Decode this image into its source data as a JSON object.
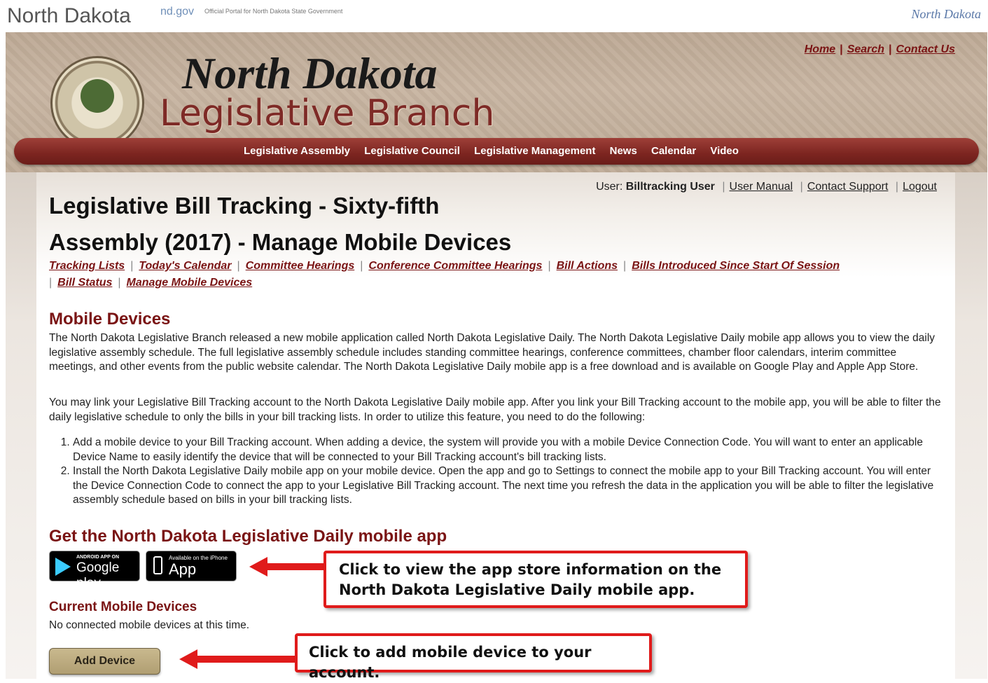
{
  "portal": {
    "name": "North Dakota",
    "ndgov": "nd.gov",
    "description": "Official Portal for North Dakota State Government",
    "logo_text": "North Dakota"
  },
  "header": {
    "title_line1": "North Dakota",
    "title_line2": "Legislative Branch",
    "top_links": [
      "Home",
      "Search",
      "Contact Us"
    ],
    "nav_items": [
      "Legislative Assembly",
      "Legislative Council",
      "Legislative Management",
      "News",
      "Calendar",
      "Video"
    ]
  },
  "user_bar": {
    "user_label": "User:",
    "user_name": "Billtracking User",
    "links": [
      "User Manual",
      "Contact Support",
      "Logout"
    ]
  },
  "page_title": "Legislative Bill Tracking - Sixty-fifth Assembly (2017) - Manage Mobile Devices",
  "sub_nav": [
    "Tracking Lists",
    "Today's Calendar",
    "Committee Hearings",
    "Conference Committee Hearings",
    "Bill Actions",
    "Bills Introduced Since Start Of Session",
    "Bill Status",
    "Manage Mobile Devices"
  ],
  "mobile_devices": {
    "title": "Mobile Devices",
    "intro": "The North Dakota Legislative Branch released a new mobile application called North Dakota Legislative Daily. The North Dakota Legislative Daily mobile app allows you to view the daily legislative assembly schedule. The full legislative assembly schedule includes standing committee hearings, conference committees, chamber floor calendars, interim committee meetings, and other events from the public website calendar. The North Dakota Legislative Daily mobile app is a free download and is available on Google Play and Apple App Store.",
    "link_info": "You may link your Legislative Bill Tracking account to the North Dakota Legislative Daily mobile app. After you link your Bill Tracking account to the mobile app, you will be able to filter the daily legislative schedule to only the bills in your bill tracking lists. In order to utilize this feature, you need to do the following:",
    "steps": [
      "Add a mobile device to your Bill Tracking account. When adding a device, the system will provide you with a mobile Device Connection Code. You will want to enter an applicable Device Name to easily identify the device that will be connected to your Bill Tracking account's bill tracking lists.",
      "Install the North Dakota Legislative Daily mobile app on your mobile device. Open the app and go to Settings to connect the mobile app to your Bill Tracking account. You will enter the Device Connection Code to connect the app to your Legislative Bill Tracking account. The next time you refresh the data in the application you will be able to filter the legislative assembly schedule based on bills in your bill tracking lists."
    ]
  },
  "get_app": {
    "title": "Get the North Dakota Legislative Daily mobile app",
    "google_small": "ANDROID APP ON",
    "google_big": "Google play",
    "apple_small": "Available on the iPhone",
    "apple_big": "App Store"
  },
  "current_devices": {
    "title": "Current Mobile Devices",
    "empty_text": "No connected mobile devices at this time.",
    "add_button": "Add Device"
  },
  "callouts": {
    "app_store": "Click to view the app store information on the North Dakota Legislative Daily mobile app.",
    "add_device": "Click to add mobile device to your account."
  },
  "colors": {
    "accent": "#7a1414",
    "nav_bar": "#7c2520",
    "callout_border": "#e01b1b",
    "button": "#b09e72"
  }
}
